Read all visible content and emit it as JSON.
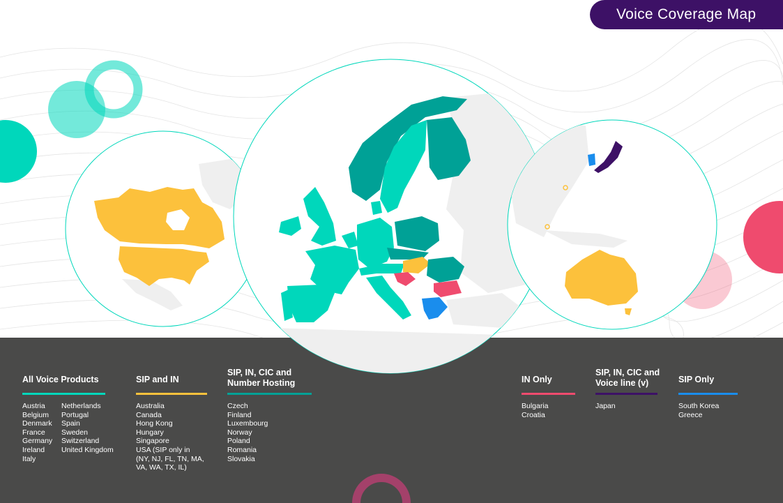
{
  "title": "Voice Coverage Map",
  "colors": {
    "all_voice": "#00d7bb",
    "sip_in": "#fcc13c",
    "sip_in_cic_nh": "#00a196",
    "in_only": "#ef4b6e",
    "sip_in_cic_voice": "#3d1166",
    "sip_only": "#1a8ded",
    "no_coverage": "#efefef",
    "panel": "#4a4a49"
  },
  "legend": [
    {
      "heading_lines": [
        "All Voice Products"
      ],
      "color_key": "all_voice",
      "columns": [
        [
          "Austria",
          "Belgium",
          "Denmark",
          "France",
          "Germany",
          "Ireland",
          "Italy"
        ],
        [
          "Netherlands",
          "Portugal",
          "Spain",
          "Sweden",
          "Switzerland",
          "United Kingdom"
        ]
      ]
    },
    {
      "heading_lines": [
        "SIP and IN"
      ],
      "color_key": "sip_in",
      "columns": [
        [
          "Australia",
          "Canada",
          "Hong Kong",
          "Hungary",
          "Singapore",
          "USA (SIP only in",
          "(NY, NJ, FL, TN, MA,",
          "VA, WA, TX, IL)"
        ]
      ]
    },
    {
      "heading_lines": [
        "SIP, IN, CIC and",
        "Number Hosting"
      ],
      "color_key": "sip_in_cic_nh",
      "columns": [
        [
          "Czech",
          "Finland",
          "Luxembourg",
          "Norway",
          "Poland",
          "Romania",
          "Slovakia"
        ]
      ]
    },
    {
      "heading_lines": [
        "IN Only"
      ],
      "color_key": "in_only",
      "columns": [
        [
          "Bulgaria",
          "Croatia"
        ]
      ]
    },
    {
      "heading_lines": [
        "SIP, IN, CIC and",
        "Voice line (v)"
      ],
      "color_key": "sip_in_cic_voice",
      "columns": [
        [
          "Japan"
        ]
      ]
    },
    {
      "heading_lines": [
        "SIP Only"
      ],
      "color_key": "sip_only",
      "columns": [
        [
          "South Korea",
          "Greece"
        ]
      ]
    }
  ]
}
